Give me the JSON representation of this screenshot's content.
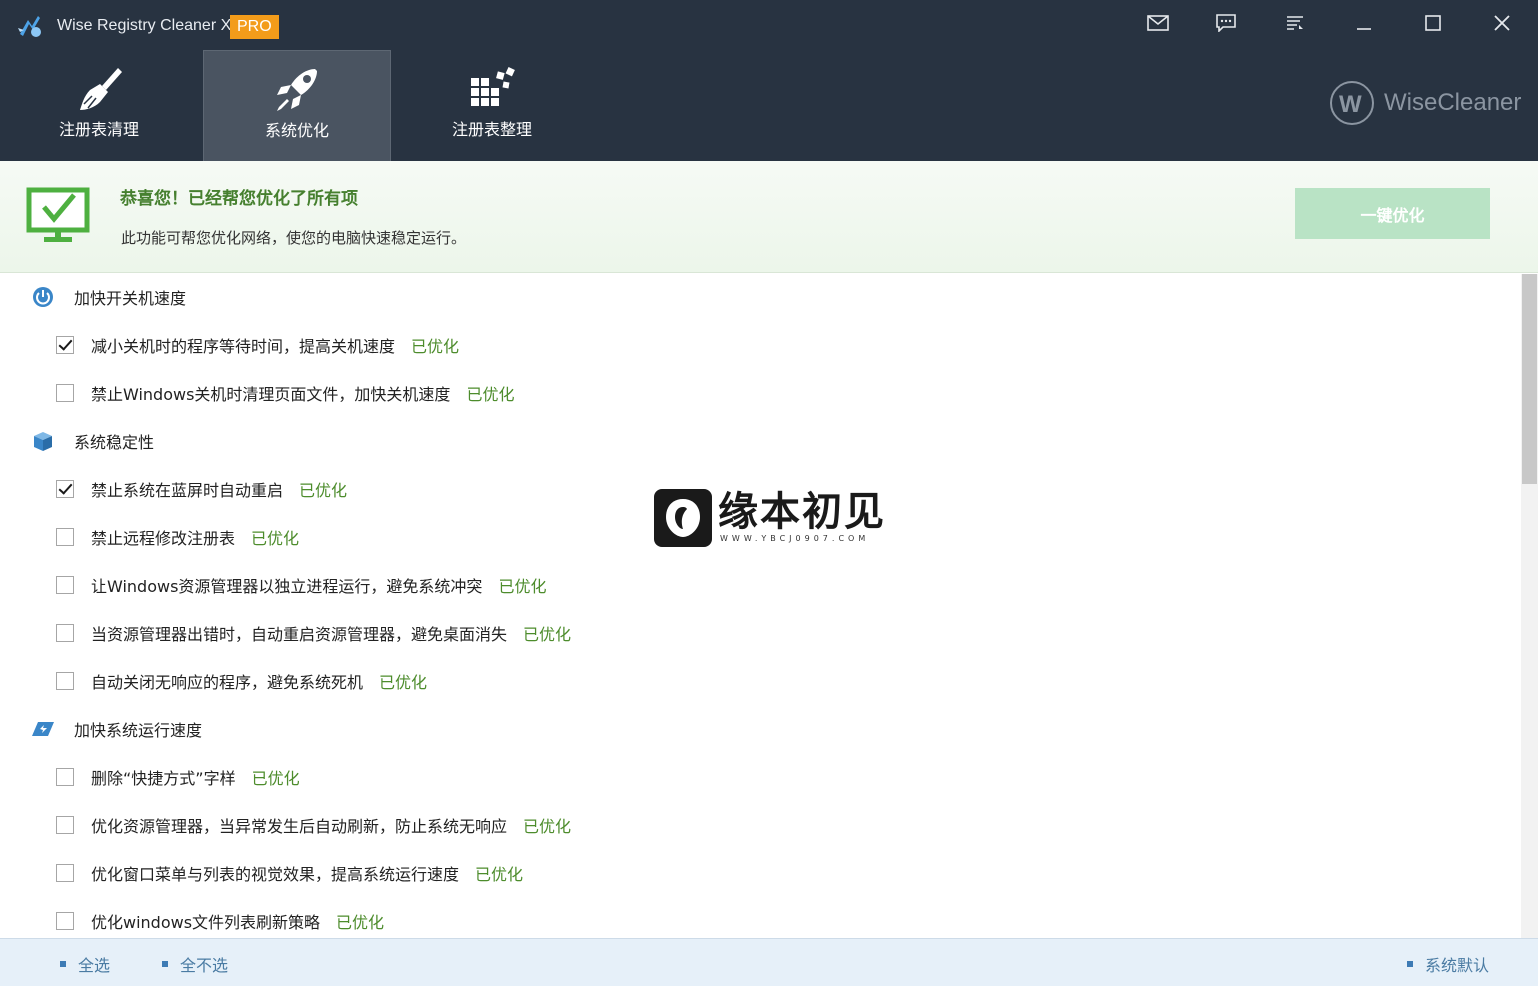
{
  "window": {
    "title": "Wise Registry Cleaner X",
    "badge": "PRO",
    "controls": [
      "mail-icon",
      "feedback-icon",
      "menu-icon",
      "minimize-icon",
      "maximize-icon",
      "close-icon"
    ]
  },
  "tabs": [
    {
      "label": "注册表清理",
      "icon": "broom-icon",
      "active": false
    },
    {
      "label": "系统优化",
      "icon": "rocket-icon",
      "active": true
    },
    {
      "label": "注册表整理",
      "icon": "blocks-icon",
      "active": false
    }
  ],
  "brand": "WiseCleaner",
  "banner": {
    "title": "恭喜您！已经帮您优化了所有项",
    "description": "此功能可帮您优化网络，使您的电脑快速稳定运行。",
    "button": "一键优化"
  },
  "categories": [
    {
      "label": "加快开关机速度",
      "icon": "power-icon",
      "items": [
        {
          "text": "减小关机时的程序等待时间，提高关机速度",
          "status": "已优化",
          "checked": true
        },
        {
          "text": "禁止Windows关机时清理页面文件，加快关机速度",
          "status": "已优化",
          "checked": false
        }
      ]
    },
    {
      "label": "系统稳定性",
      "icon": "box-icon",
      "items": [
        {
          "text": "禁止系统在蓝屏时自动重启",
          "status": "已优化",
          "checked": true
        },
        {
          "text": "禁止远程修改注册表",
          "status": "已优化",
          "checked": false
        },
        {
          "text": "让Windows资源管理器以独立进程运行，避免系统冲突",
          "status": "已优化",
          "checked": false
        },
        {
          "text": "当资源管理器出错时，自动重启资源管理器，避免桌面消失",
          "status": "已优化",
          "checked": false
        },
        {
          "text": "自动关闭无响应的程序，避免系统死机",
          "status": "已优化",
          "checked": false
        }
      ]
    },
    {
      "label": "加快系统运行速度",
      "icon": "speed-icon",
      "items": [
        {
          "text": "删除“快捷方式”字样",
          "status": "已优化",
          "checked": false
        },
        {
          "text": "优化资源管理器，当异常发生后自动刷新，防止系统无响应",
          "status": "已优化",
          "checked": false
        },
        {
          "text": "优化窗口菜单与列表的视觉效果，提高系统运行速度",
          "status": "已优化",
          "checked": false
        },
        {
          "text": "优化windows文件列表刷新策略",
          "status": "已优化",
          "checked": false
        }
      ]
    }
  ],
  "watermark": {
    "title": "缘本初见",
    "url": "WWW.YBCJ0907.COM"
  },
  "footer": {
    "select_all": "全选",
    "select_none": "全不选",
    "system_default": "系统默认"
  },
  "colors": {
    "header_bg": "#283341",
    "active_tab_bg": "#4a5461",
    "pro_badge": "#f39c1a",
    "success_green": "#46802f",
    "status_green": "#4d8c2c",
    "button_disabled": "#b9e3c5",
    "footer_bg": "#e6f0f9",
    "footer_link": "#4a7ba3"
  }
}
